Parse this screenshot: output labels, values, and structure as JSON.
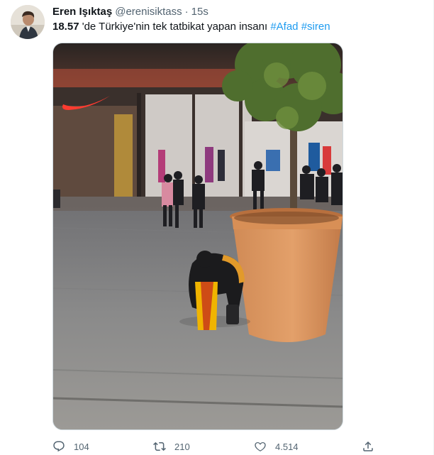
{
  "tweet": {
    "author": {
      "display_name": "Eren Işıktaş",
      "handle": "@erenisiktass",
      "separator": "·",
      "time": "15s"
    },
    "text": {
      "time_bold": "18.57",
      "body": " 'de Türkiye'nin tek tatbikat yapan  insanı ",
      "hashtags": [
        "#Afad",
        "#siren"
      ]
    },
    "actions": {
      "reply_count": "104",
      "retweet_count": "210",
      "like_count": "4.514"
    },
    "icons": [
      "reply-icon",
      "retweet-icon",
      "like-icon",
      "share-icon"
    ],
    "colors": {
      "link": "#1d9bf0",
      "secondary_text": "#536471",
      "primary_text": "#0f1419",
      "border": "#cfd9de"
    }
  }
}
